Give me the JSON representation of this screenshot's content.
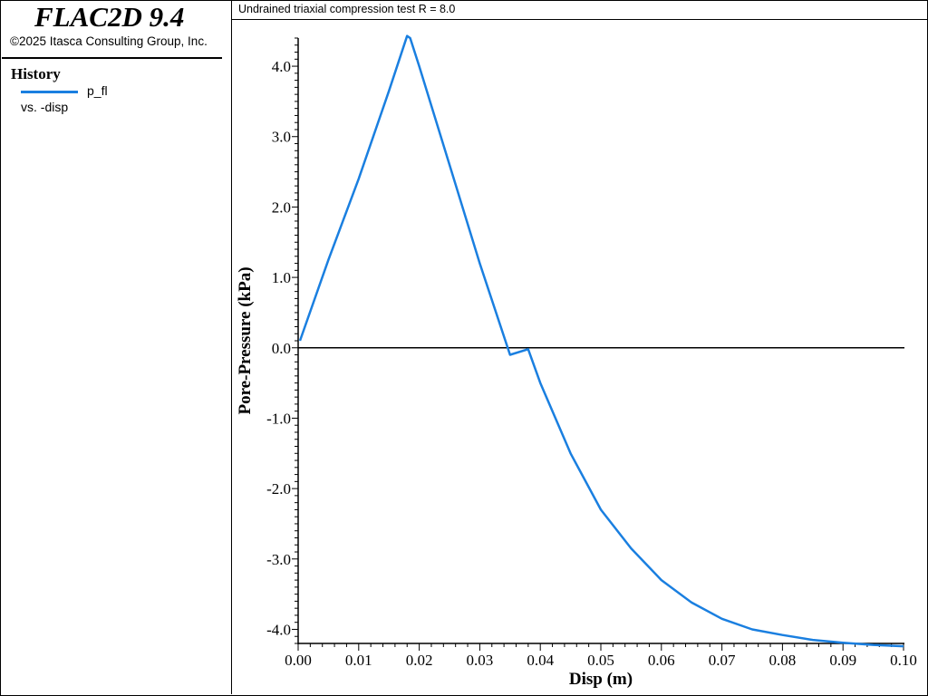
{
  "app": {
    "title": "FLAC2D 9.4",
    "copyright": "©2025 Itasca Consulting Group, Inc."
  },
  "legend": {
    "heading": "History",
    "series_name": "p_fl",
    "vs_label": "vs. -disp",
    "color": "#1a7fe0"
  },
  "plot": {
    "title": "Undrained triaxial compression test R = 8.0"
  },
  "chart_data": {
    "type": "line",
    "title": "Undrained triaxial compression test R = 8.0",
    "xlabel": "Disp (m)",
    "ylabel": "Pore-Pressure (kPa)",
    "xlim": [
      0.0,
      0.1
    ],
    "ylim": [
      -4.2,
      4.4
    ],
    "x_ticks": [
      0.0,
      0.01,
      0.02,
      0.03,
      0.04,
      0.05,
      0.06,
      0.07,
      0.08,
      0.09,
      0.1
    ],
    "x_tick_labels": [
      "0.00",
      "0.01",
      "0.02",
      "0.03",
      "0.04",
      "0.05",
      "0.06",
      "0.07",
      "0.08",
      "0.09",
      "0.10"
    ],
    "y_ticks": [
      4.0,
      3.0,
      2.0,
      1.0,
      0.0,
      -1.0,
      -2.0,
      -3.0,
      -4.0
    ],
    "y_tick_labels": [
      "4.0",
      "3.0",
      "2.0",
      "1.0",
      "0.0",
      "-1.0",
      "-2.0",
      "-3.0",
      "-4.0"
    ],
    "zero_line": true,
    "grid": false,
    "series": [
      {
        "name": "p_fl",
        "color": "#1a7fe0",
        "x": [
          0.0003,
          0.005,
          0.01,
          0.015,
          0.018,
          0.0185,
          0.02,
          0.025,
          0.03,
          0.035,
          0.038,
          0.04,
          0.045,
          0.05,
          0.055,
          0.06,
          0.065,
          0.07,
          0.075,
          0.08,
          0.085,
          0.09,
          0.095,
          0.1
        ],
        "y": [
          0.1,
          1.25,
          2.4,
          3.65,
          4.43,
          4.4,
          4.0,
          2.6,
          1.2,
          -0.1,
          -0.02,
          -0.5,
          -1.5,
          -2.3,
          -2.85,
          -3.3,
          -3.62,
          -3.85,
          -4.0,
          -4.08,
          -4.15,
          -4.19,
          -4.22,
          -4.24
        ]
      }
    ]
  }
}
